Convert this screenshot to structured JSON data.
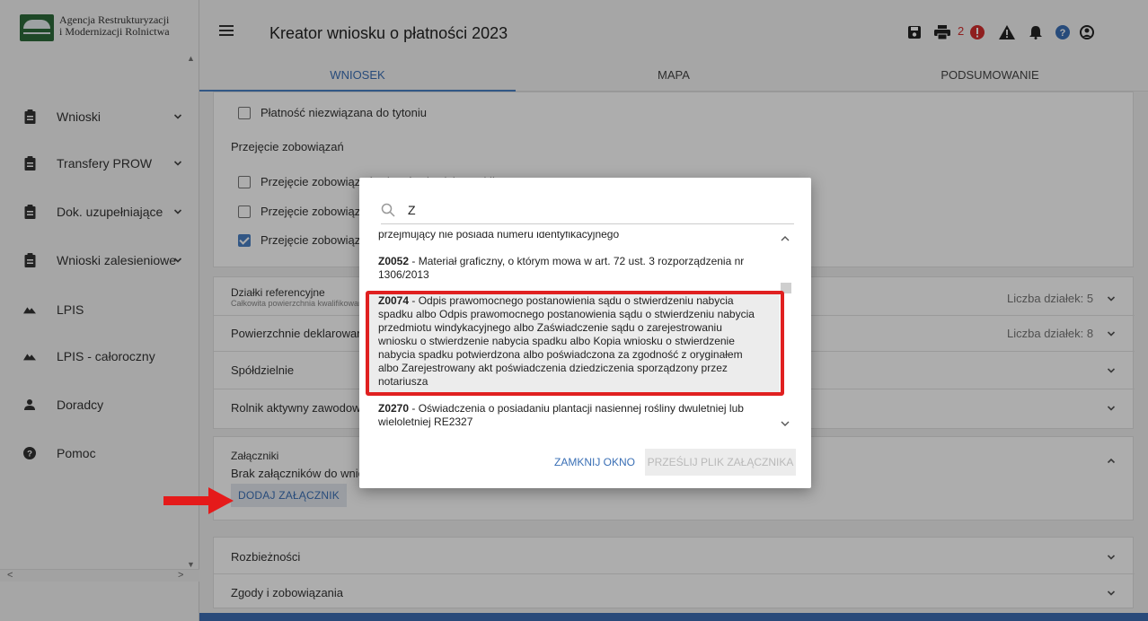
{
  "sidebar": {
    "logo_line1": "Agencja Restrukturyzacji",
    "logo_line2": "i Modernizacji Rolnictwa",
    "items": [
      {
        "label": "Wnioski"
      },
      {
        "label": "Transfery PROW"
      },
      {
        "label": "Dok. uzupełniające"
      },
      {
        "label": "Wnioski zalesieniowe"
      },
      {
        "label": "LPIS"
      },
      {
        "label": "LPIS - całoroczny"
      },
      {
        "label": "Doradcy"
      },
      {
        "label": "Pomoc"
      }
    ]
  },
  "header": {
    "title": "Kreator wniosku o płatności 2023",
    "alert_count": "2"
  },
  "tabs": [
    "WNIOSEK",
    "MAPA",
    "PODSUMOWANIE"
  ],
  "form": {
    "tobacco_label": "Płatność niezwiązana do tytoniu",
    "takeover_heading": "Przejęcie zobowiązań",
    "takeover_1": "Przejęcie zobowiązań rolno-środowiskowo-klimatycz",
    "takeover_2": "Przejęcie zobowiązań",
    "takeover_3": "Przejęcie zobowiązań",
    "parcels_label": "Działki referencyjne",
    "parcels_sub": "Całkowita powierzchnia kwalifikowana",
    "parcels_count": "Liczba działek: 5",
    "declared_label": "Powierzchnie deklarowane",
    "declared_count": "Liczba działek: 8",
    "coop_label": "Spółdzielnie",
    "active_farmer_label": "Rolnik aktywny zawodowo",
    "attachments_label": "Załączniki",
    "no_attachments": "Brak załączników do wniosku",
    "add_attachment": "DODAJ ZAŁĄCZNIK",
    "discrepancies_label": "Rozbieżności",
    "consents_label": "Zgody i zobowiązania"
  },
  "dialog": {
    "search_value": "Z",
    "items": [
      {
        "code": "",
        "text": "przejmujący nie posiada numeru identyfikacyjnego"
      },
      {
        "code": "Z0052",
        "text": " - Materiał graficzny, o którym mowa w art. 72 ust. 3 rozporządzenia nr 1306/2013"
      },
      {
        "code": "Z0074",
        "text": " - Odpis prawomocnego postanowienia sądu o stwierdzeniu nabycia spadku albo Odpis prawomocnego postanowienia sądu o stwierdzeniu nabycia przedmiotu windykacyjnego albo Zaświadczenie sądu o zarejestrowaniu wniosku o stwierdzenie nabycia spadku albo Kopia wniosku o stwierdzenie nabycia spadku potwierdzona albo poświadczona za zgodność z oryginałem albo Zarejestrowany akt poświadczenia dziedziczenia sporządzony przez notariusza"
      },
      {
        "code": "Z0270",
        "text": " - Oświadczenia o posiadaniu plantacji nasiennej rośliny dwuletniej lub wieloletniej RE2327"
      }
    ],
    "close_label": "ZAMKNIJ OKNO",
    "send_label": "PRZEŚLIJ PLIK ZAŁĄCZNIKA"
  },
  "colors": {
    "accent": "#3a6fb5",
    "highlight_box": "#e02020",
    "arrow": "#e51a1a",
    "alert_red": "#d32f2f"
  }
}
